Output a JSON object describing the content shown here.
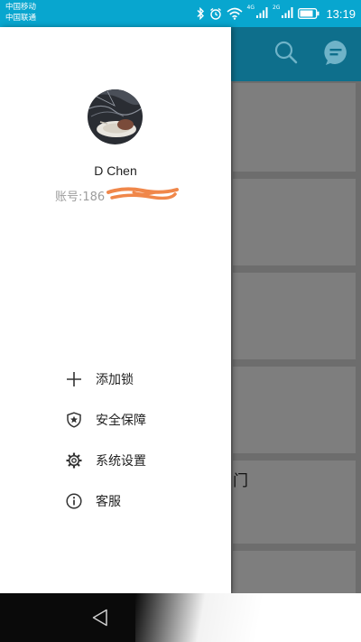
{
  "status_bar": {
    "carrier_1": "中国移动",
    "carrier_2": "中国联通",
    "network_tag_1": "4G",
    "network_tag_2": "2G",
    "time": "13:19",
    "icons": [
      "bluetooth-icon",
      "alarm-icon",
      "wifi-icon",
      "signal-icon",
      "signal-icon",
      "battery-icon"
    ]
  },
  "header": {
    "icons": [
      "search-icon",
      "message-icon"
    ]
  },
  "drawer": {
    "user_name": "D Chen",
    "account_label": "账号:186"
  },
  "menu": {
    "items": [
      {
        "label": "添加锁",
        "icon": "plus-icon"
      },
      {
        "label": "安全保障",
        "icon": "shield-star-icon"
      },
      {
        "label": "系统设置",
        "icon": "gear-icon"
      },
      {
        "label": "客服",
        "icon": "info-icon"
      }
    ]
  },
  "background_list": {
    "partial_text": "门"
  },
  "nav_bar": {
    "icons": [
      "back-icon"
    ]
  },
  "colors": {
    "status_bar": "#08a6cf",
    "header": "#0e6f8c",
    "drawer": "#ffffff",
    "scrim": "#6d6d6d",
    "redaction": "#f0874a"
  }
}
